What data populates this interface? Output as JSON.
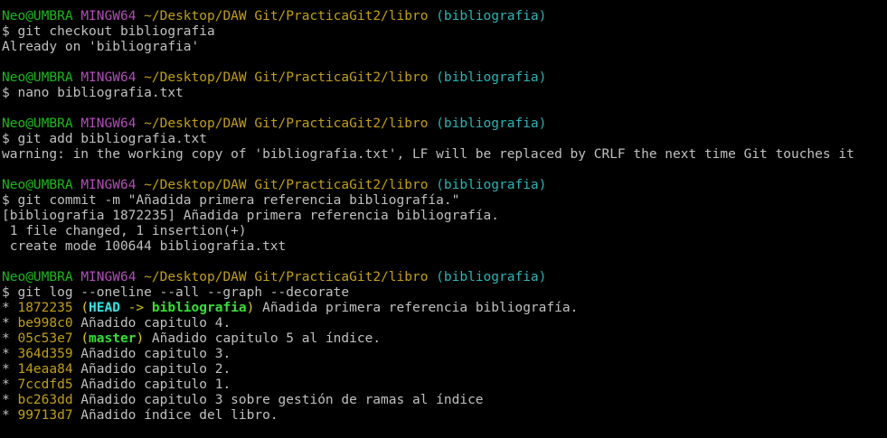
{
  "prompt": {
    "user": "Neo@UMBRA",
    "system": "MINGW64",
    "path": "~/Desktop/DAW Git/PracticaGit2/libro",
    "branch": "(bibliografia)"
  },
  "blocks": [
    {
      "command": "$ git checkout bibliografia",
      "output": [
        "Already on 'bibliografia'"
      ]
    },
    {
      "command": "$ nano bibliografia.txt",
      "output": []
    },
    {
      "command": "$ git add bibliografia.txt",
      "output": [
        "warning: in the working copy of 'bibliografia.txt', LF will be replaced by CRLF the next time Git touches it"
      ]
    },
    {
      "command": "$ git commit -m \"Añadida primera referencia bibliografía.\"",
      "output": [
        "[bibliografia 1872235] Añadida primera referencia bibliografía.",
        " 1 file changed, 1 insertion(+)",
        " create mode 100644 bibliografia.txt"
      ]
    },
    {
      "command": "$ git log --oneline --all --graph --decorate",
      "output": []
    }
  ],
  "log": [
    {
      "graph": "* ",
      "hash": "1872235",
      "head": "HEAD",
      "arrow": " -> ",
      "branch_ref": "bibliografia",
      "message": " Añadida primera referencia bibliografía."
    },
    {
      "graph": "* ",
      "hash": "be998c0",
      "message": " Añadido capitulo 4."
    },
    {
      "graph": "* ",
      "hash": "05c53e7",
      "branch_ref": "master",
      "message": " Añadido capitulo 5 al índice."
    },
    {
      "graph": "* ",
      "hash": "364d359",
      "message": " Añadido capitulo 3."
    },
    {
      "graph": "* ",
      "hash": "14eaa84",
      "message": " Añadido capitulo 2."
    },
    {
      "graph": "* ",
      "hash": "7ccdfd5",
      "message": " Añadido capitulo 1."
    },
    {
      "graph": "* ",
      "hash": "bc263dd",
      "message": " Añadido capitulo 3 sobre gestión de ramas al índice"
    },
    {
      "graph": "* ",
      "hash": "99713d7",
      "message": " Añadido índice del libro."
    }
  ]
}
